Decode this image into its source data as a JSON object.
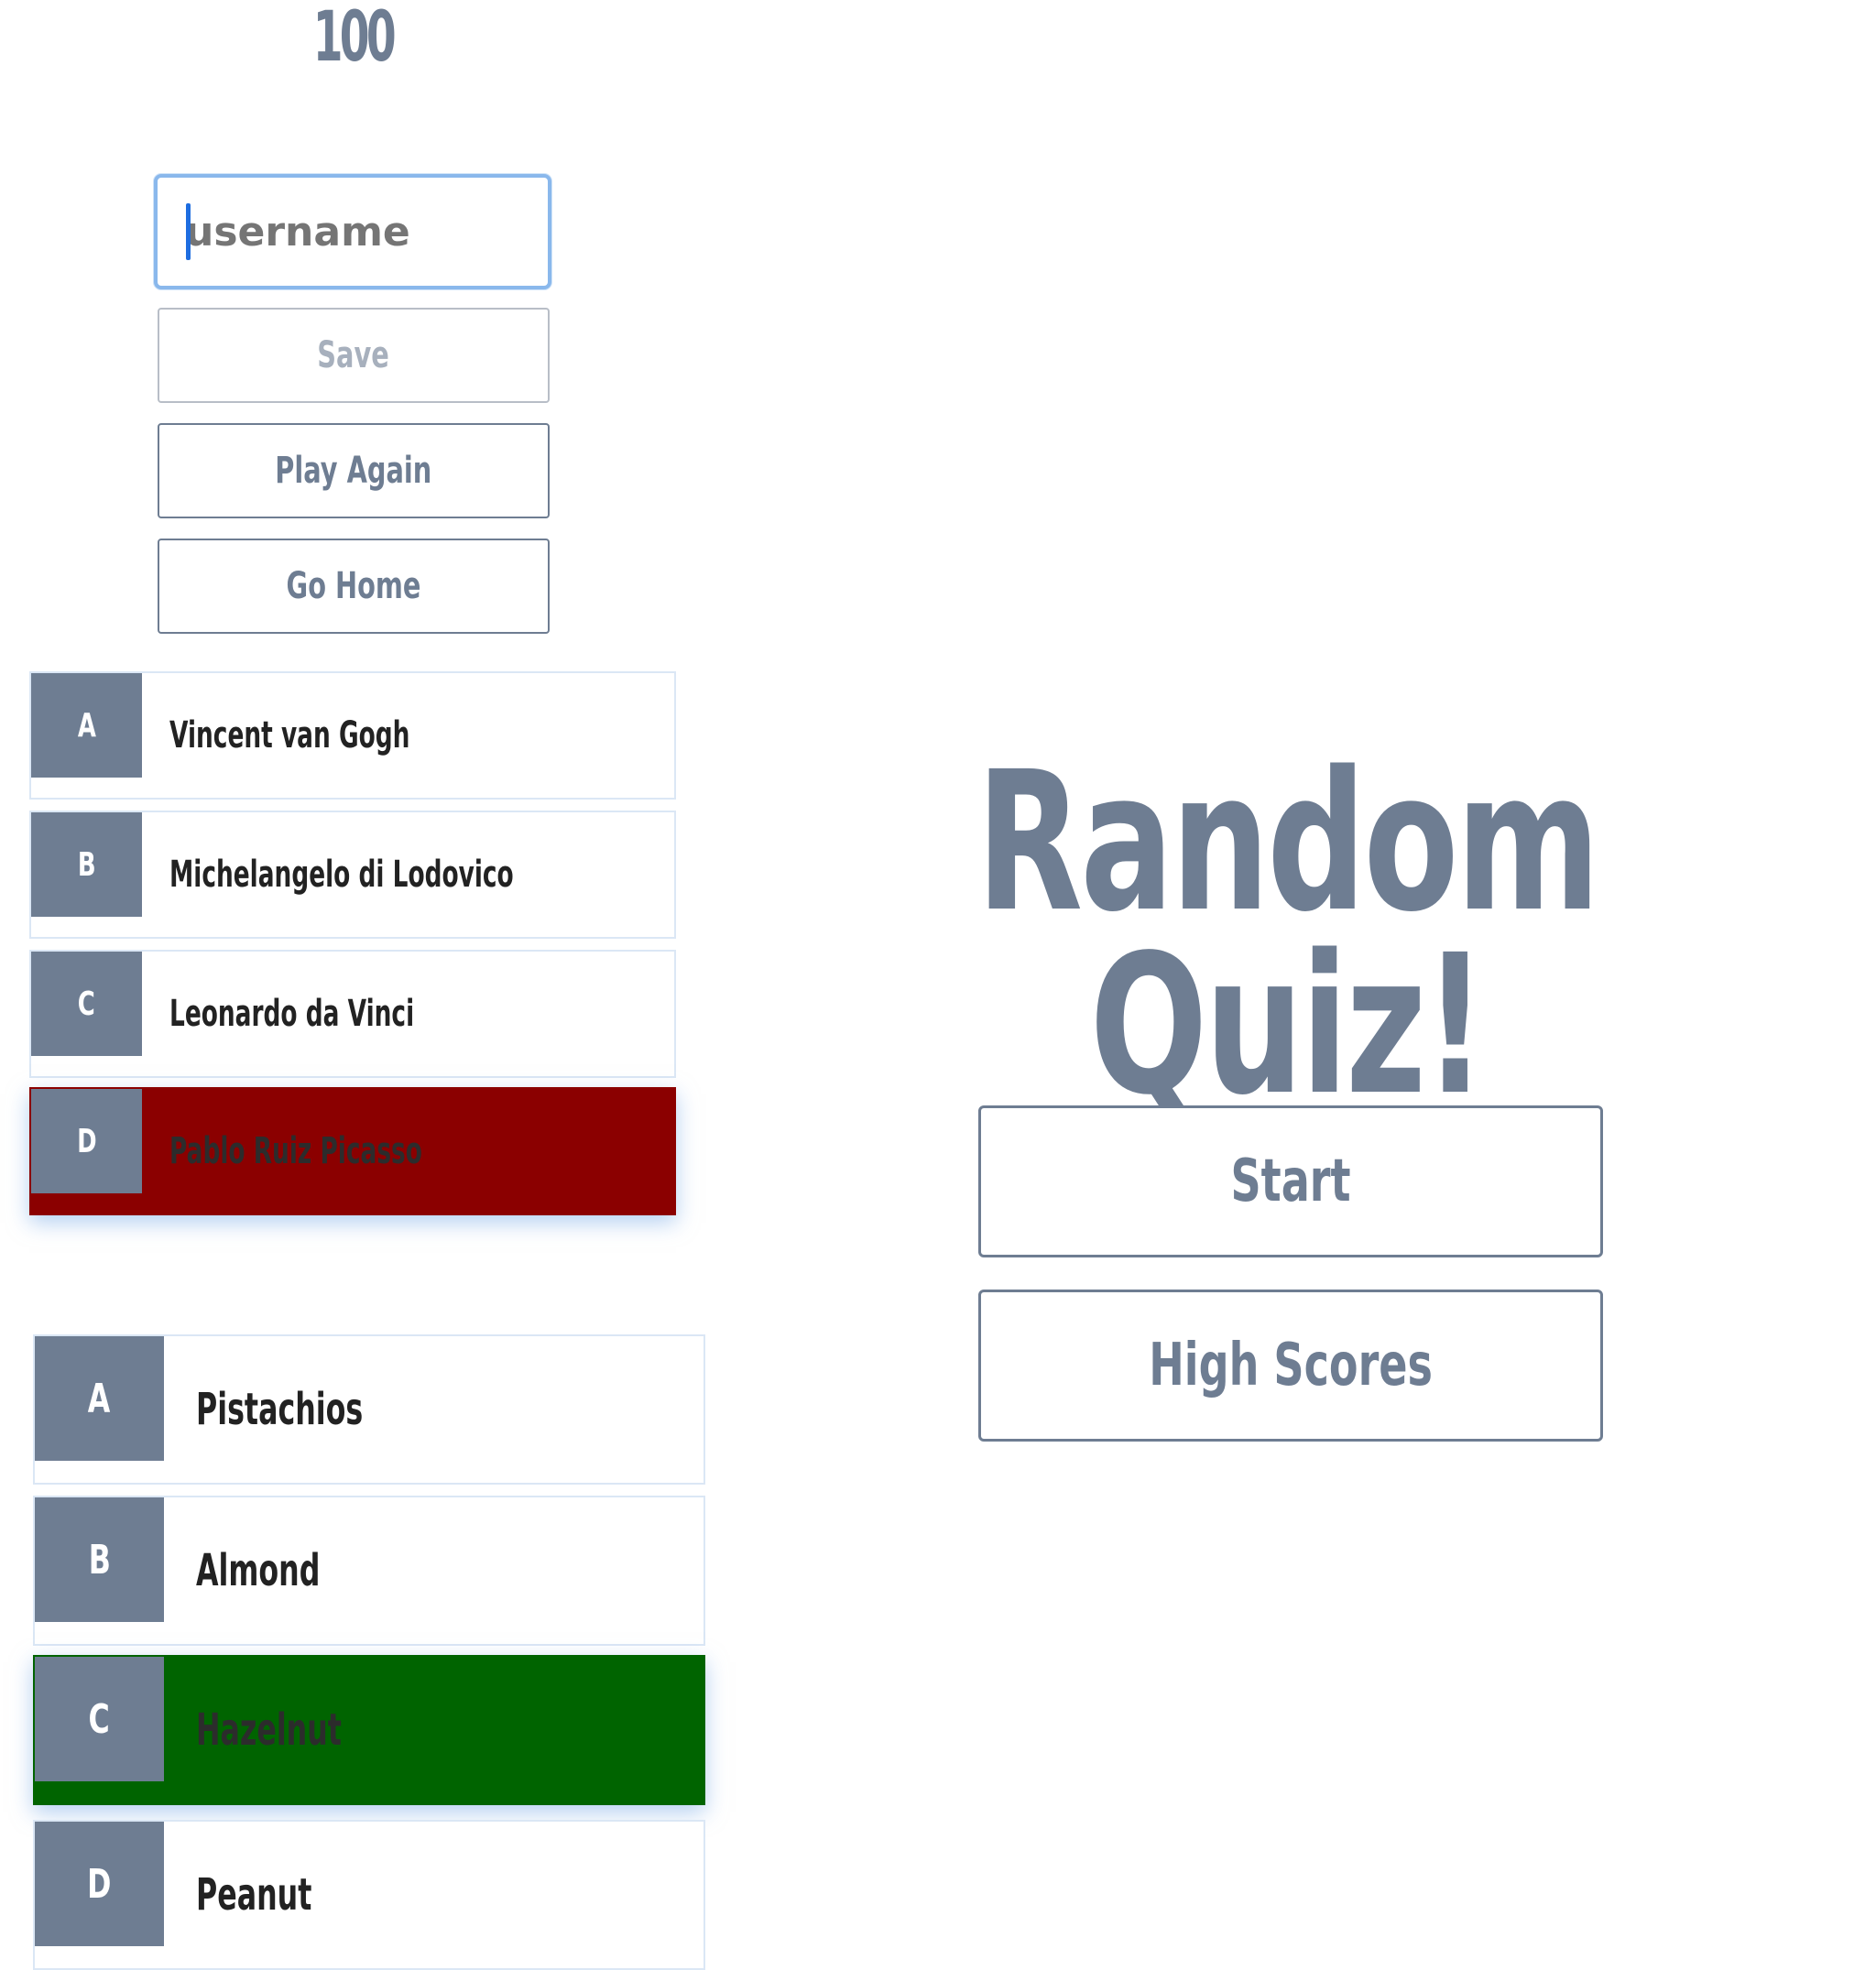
{
  "end_screen": {
    "final_score": "100",
    "username_placeholder": "username",
    "save_label": "Save",
    "play_again_label": "Play Again",
    "go_home_label": "Go Home"
  },
  "question_1": {
    "choices": [
      {
        "prefix": "A",
        "text": "Vincent van Gogh",
        "state": "neutral"
      },
      {
        "prefix": "B",
        "text": "Michelangelo di Lodovico",
        "state": "neutral"
      },
      {
        "prefix": "C",
        "text": "Leonardo da Vinci",
        "state": "neutral"
      },
      {
        "prefix": "D",
        "text": "Pablo Ruiz Picasso",
        "state": "incorrect"
      }
    ]
  },
  "question_2": {
    "choices": [
      {
        "prefix": "A",
        "text": "Pistachios",
        "state": "neutral"
      },
      {
        "prefix": "B",
        "text": "Almond",
        "state": "neutral"
      },
      {
        "prefix": "C",
        "text": "Hazelnut",
        "state": "correct"
      },
      {
        "prefix": "D",
        "text": "Peanut",
        "state": "neutral"
      }
    ]
  },
  "home": {
    "title": "Random Quiz!",
    "start_label": "Start",
    "high_scores_label": "High Scores"
  },
  "colors": {
    "accent": "#6e7d92",
    "incorrect": "#8b0000",
    "correct": "#006400",
    "focus_ring": "#8ab8ec"
  }
}
